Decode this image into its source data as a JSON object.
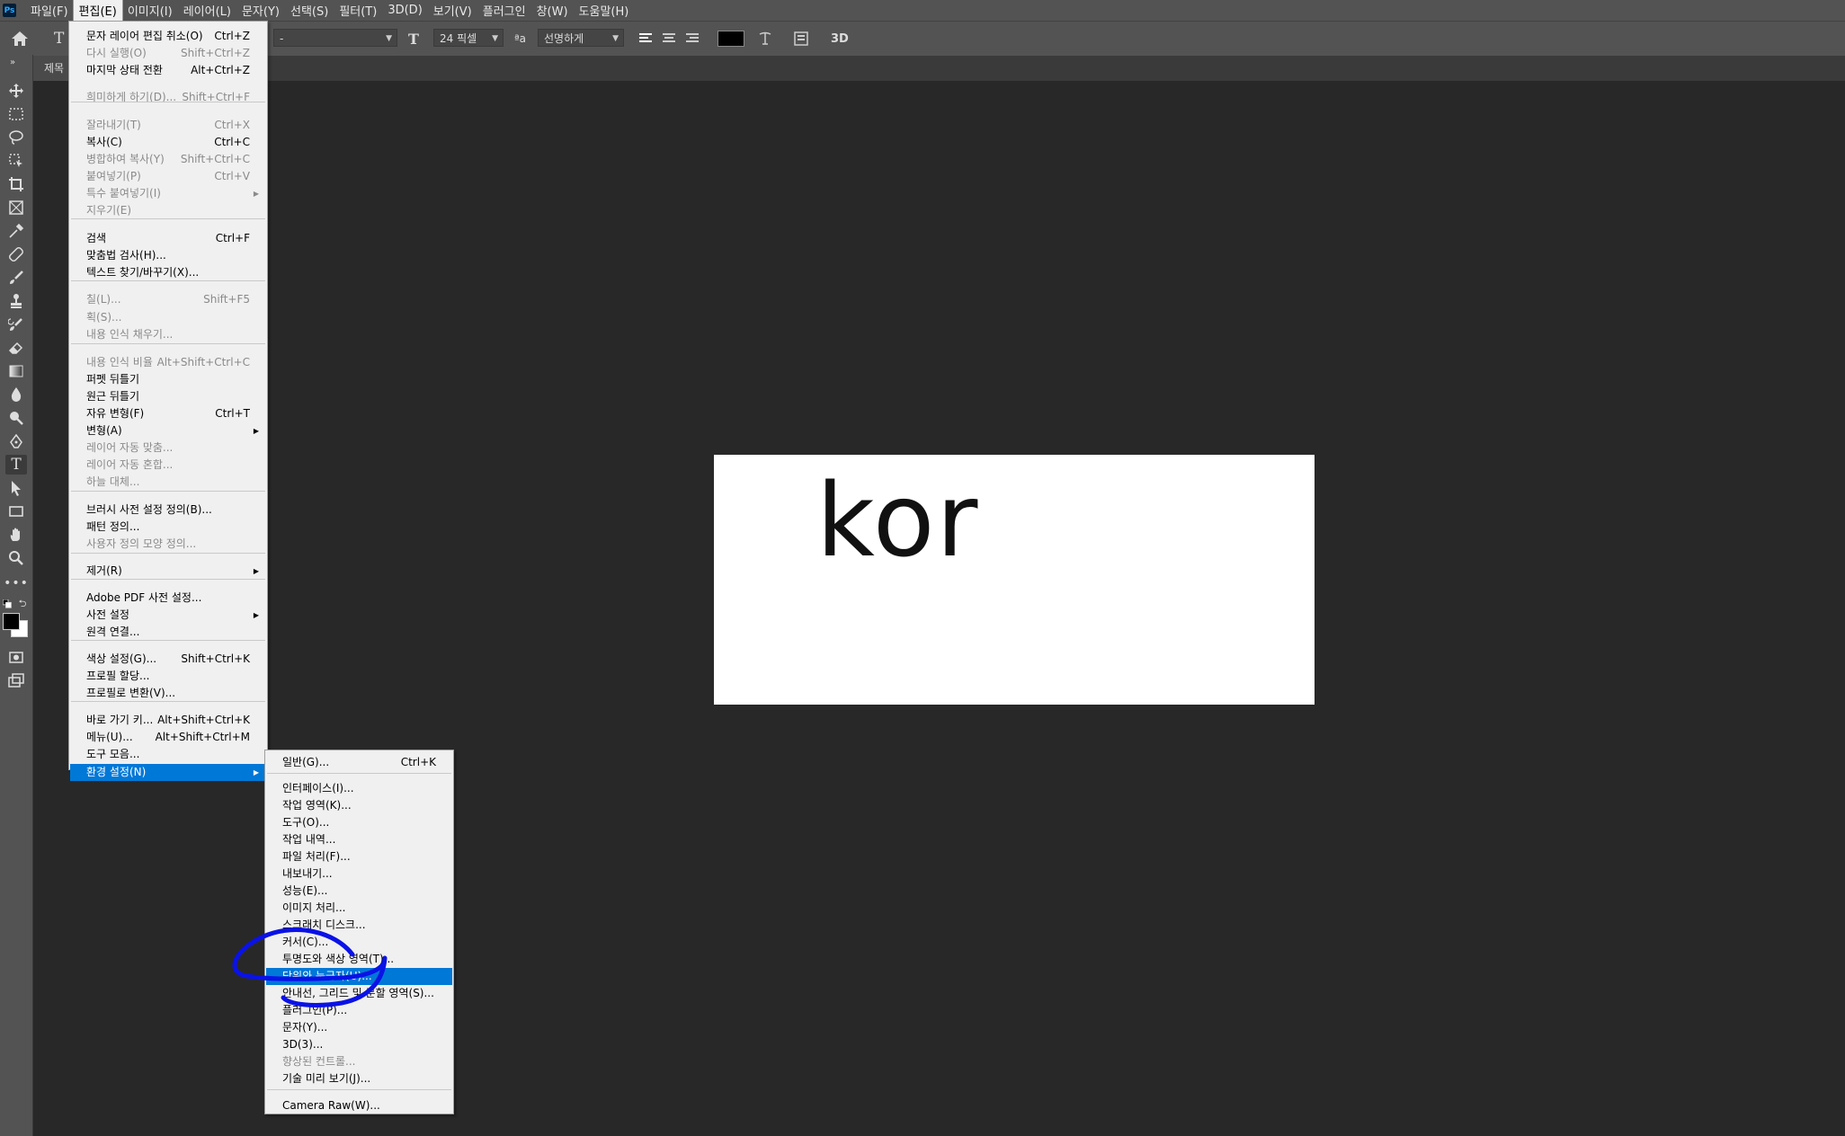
{
  "app": {
    "logo": "Ps"
  },
  "menubar": {
    "items": [
      "파일(F)",
      "편집(E)",
      "이미지(I)",
      "레이어(L)",
      "문자(Y)",
      "선택(S)",
      "필터(T)",
      "3D(D)",
      "보기(V)",
      "플러그인",
      "창(W)",
      "도움말(H)"
    ],
    "active_index": 1
  },
  "options_bar": {
    "font_style_value": "-",
    "font_size_value": "24 픽셀",
    "aa_label": "ªa",
    "antialias_value": "선명하게",
    "text_color": "#000000",
    "threed_label": "3D"
  },
  "document": {
    "tab_label": "제목",
    "canvas_text": "kor"
  },
  "edit_menu": {
    "items": [
      {
        "label": "문자 레이어 편집 취소(O)",
        "shortcut": "Ctrl+Z",
        "disabled": false
      },
      {
        "label": "다시 실행(O)",
        "shortcut": "Shift+Ctrl+Z",
        "disabled": true
      },
      {
        "label": "마지막 상태 전환",
        "shortcut": "Alt+Ctrl+Z",
        "disabled": false
      },
      {
        "label": "희미하게 하기(D)...",
        "shortcut": "Shift+Ctrl+F",
        "disabled": true
      },
      {
        "label": "잘라내기(T)",
        "shortcut": "Ctrl+X",
        "disabled": true
      },
      {
        "label": "복사(C)",
        "shortcut": "Ctrl+C",
        "disabled": false
      },
      {
        "label": "병합하여 복사(Y)",
        "shortcut": "Shift+Ctrl+C",
        "disabled": true
      },
      {
        "label": "붙여넣기(P)",
        "shortcut": "Ctrl+V",
        "disabled": true
      },
      {
        "label": "특수 붙여넣기(I)",
        "shortcut": "",
        "disabled": true,
        "submenu": true
      },
      {
        "label": "지우기(E)",
        "shortcut": "",
        "disabled": true
      },
      {
        "label": "검색",
        "shortcut": "Ctrl+F",
        "disabled": false
      },
      {
        "label": "맞춤법 검사(H)...",
        "shortcut": "",
        "disabled": false
      },
      {
        "label": "텍스트 찾기/바꾸기(X)...",
        "shortcut": "",
        "disabled": false
      },
      {
        "label": "칠(L)...",
        "shortcut": "Shift+F5",
        "disabled": true
      },
      {
        "label": "획(S)...",
        "shortcut": "",
        "disabled": true
      },
      {
        "label": "내용 인식 채우기...",
        "shortcut": "",
        "disabled": true
      },
      {
        "label": "내용 인식 비율",
        "shortcut": "Alt+Shift+Ctrl+C",
        "disabled": true
      },
      {
        "label": "퍼펫 뒤틀기",
        "shortcut": "",
        "disabled": false
      },
      {
        "label": "원근 뒤틀기",
        "shortcut": "",
        "disabled": false
      },
      {
        "label": "자유 변형(F)",
        "shortcut": "Ctrl+T",
        "disabled": false
      },
      {
        "label": "변형(A)",
        "shortcut": "",
        "disabled": false,
        "submenu": true
      },
      {
        "label": "레이어 자동 맞춤...",
        "shortcut": "",
        "disabled": true
      },
      {
        "label": "레이어 자동 혼합...",
        "shortcut": "",
        "disabled": true
      },
      {
        "label": "하늘 대체...",
        "shortcut": "",
        "disabled": true
      },
      {
        "label": "브러시 사전 설정 정의(B)...",
        "shortcut": "",
        "disabled": false
      },
      {
        "label": "패턴 정의...",
        "shortcut": "",
        "disabled": false
      },
      {
        "label": "사용자 정의 모양 정의...",
        "shortcut": "",
        "disabled": true
      },
      {
        "label": "제거(R)",
        "shortcut": "",
        "disabled": false,
        "submenu": true
      },
      {
        "label": "Adobe PDF 사전 설정...",
        "shortcut": "",
        "disabled": false
      },
      {
        "label": "사전 설정",
        "shortcut": "",
        "disabled": false,
        "submenu": true
      },
      {
        "label": "원격 연결...",
        "shortcut": "",
        "disabled": false
      },
      {
        "label": "색상 설정(G)...",
        "shortcut": "Shift+Ctrl+K",
        "disabled": false
      },
      {
        "label": "프로필 할당...",
        "shortcut": "",
        "disabled": false
      },
      {
        "label": "프로필로 변환(V)...",
        "shortcut": "",
        "disabled": false
      },
      {
        "label": "바로 가기 키...",
        "shortcut": "Alt+Shift+Ctrl+K",
        "disabled": false
      },
      {
        "label": "메뉴(U)...",
        "shortcut": "Alt+Shift+Ctrl+M",
        "disabled": false
      },
      {
        "label": "도구 모음...",
        "shortcut": "",
        "disabled": false
      },
      {
        "label": "환경 설정(N)",
        "shortcut": "",
        "disabled": false,
        "submenu": true,
        "highlighted": true
      }
    ]
  },
  "preferences_menu": {
    "items": [
      {
        "label": "일반(G)...",
        "shortcut": "Ctrl+K",
        "disabled": false
      },
      {
        "label": "인터페이스(I)...",
        "shortcut": "",
        "disabled": false
      },
      {
        "label": "작업 영역(K)...",
        "shortcut": "",
        "disabled": false
      },
      {
        "label": "도구(O)...",
        "shortcut": "",
        "disabled": false
      },
      {
        "label": "작업 내역...",
        "shortcut": "",
        "disabled": false
      },
      {
        "label": "파일 처리(F)...",
        "shortcut": "",
        "disabled": false
      },
      {
        "label": "내보내기...",
        "shortcut": "",
        "disabled": false
      },
      {
        "label": "성능(E)...",
        "shortcut": "",
        "disabled": false
      },
      {
        "label": "이미지 처리...",
        "shortcut": "",
        "disabled": false
      },
      {
        "label": "스크래치 디스크...",
        "shortcut": "",
        "disabled": false
      },
      {
        "label": "커서(C)...",
        "shortcut": "",
        "disabled": false
      },
      {
        "label": "투명도와 색상 영역(T)...",
        "shortcut": "",
        "disabled": false
      },
      {
        "label": "단위와 눈금자(U)...",
        "shortcut": "",
        "disabled": false,
        "highlighted": true
      },
      {
        "label": "안내선, 그리드 및 분할 영역(S)...",
        "shortcut": "",
        "disabled": false
      },
      {
        "label": "플러그인(P)...",
        "shortcut": "",
        "disabled": false
      },
      {
        "label": "문자(Y)...",
        "shortcut": "",
        "disabled": false
      },
      {
        "label": "3D(3)...",
        "shortcut": "",
        "disabled": false
      },
      {
        "label": "향상된 컨트롤...",
        "shortcut": "",
        "disabled": true
      },
      {
        "label": "기술 미리 보기(J)...",
        "shortcut": "",
        "disabled": false
      },
      {
        "label": "Camera Raw(W)...",
        "shortcut": "",
        "disabled": false
      }
    ]
  },
  "colors": {
    "highlight": "#0078d7",
    "annotation_stroke": "#0a12e6",
    "foreground_swatch": "#000000",
    "background_swatch": "#ffffff"
  }
}
